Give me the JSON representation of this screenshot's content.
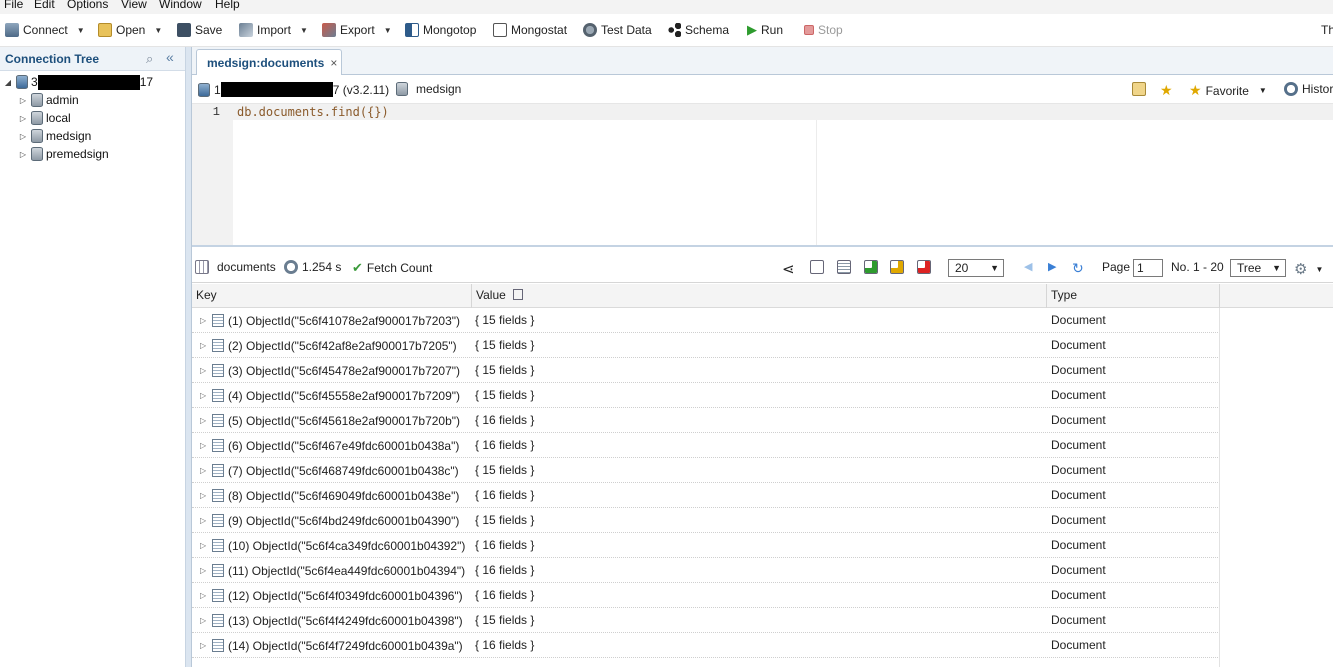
{
  "menu": [
    "File",
    "Edit",
    "Options",
    "View",
    "Window",
    "Help"
  ],
  "toolbar": {
    "connect": "Connect",
    "open": "Open",
    "save": "Save",
    "import": "Import",
    "export": "Export",
    "mongotop": "Mongotop",
    "mongostat": "Mongostat",
    "test_data": "Test Data",
    "schema": "Schema",
    "run": "Run",
    "stop": "Stop",
    "overflow": "Th"
  },
  "connection_tree": {
    "title": "Connection Tree",
    "root_prefix": "3",
    "root_suffix": "17",
    "databases": [
      "admin",
      "local",
      "medsign",
      "premedsign"
    ]
  },
  "tab": {
    "label": "medsign:documents",
    "close": "×"
  },
  "info": {
    "server_prefix": "1",
    "server_suffix": "7 (v3.2.11)",
    "database": "medsign",
    "favorite": "Favorite",
    "history": "Histor"
  },
  "editor": {
    "line_number": "1",
    "code": "db.documents.find({})"
  },
  "results": {
    "collection": "documents",
    "time": "1.254 s",
    "fetch_count": "Fetch Count",
    "page_size": "20",
    "page_label": "Page",
    "page": "1",
    "range": "No. 1 - 20",
    "view_mode": "Tree"
  },
  "table": {
    "columns": [
      "Key",
      "Value",
      "Type"
    ],
    "rows": [
      {
        "key": "(1) ObjectId(\"5c6f41078e2af900017b7203\")",
        "value": "{ 15 fields }",
        "type": "Document"
      },
      {
        "key": "(2) ObjectId(\"5c6f42af8e2af900017b7205\")",
        "value": "{ 15 fields }",
        "type": "Document"
      },
      {
        "key": "(3) ObjectId(\"5c6f45478e2af900017b7207\")",
        "value": "{ 15 fields }",
        "type": "Document"
      },
      {
        "key": "(4) ObjectId(\"5c6f45558e2af900017b7209\")",
        "value": "{ 15 fields }",
        "type": "Document"
      },
      {
        "key": "(5) ObjectId(\"5c6f45618e2af900017b720b\")",
        "value": "{ 16 fields }",
        "type": "Document"
      },
      {
        "key": "(6) ObjectId(\"5c6f467e49fdc60001b0438a\")",
        "value": "{ 16 fields }",
        "type": "Document"
      },
      {
        "key": "(7) ObjectId(\"5c6f468749fdc60001b0438c\")",
        "value": "{ 15 fields }",
        "type": "Document"
      },
      {
        "key": "(8) ObjectId(\"5c6f469049fdc60001b0438e\")",
        "value": "{ 16 fields }",
        "type": "Document"
      },
      {
        "key": "(9) ObjectId(\"5c6f4bd249fdc60001b04390\")",
        "value": "{ 15 fields }",
        "type": "Document"
      },
      {
        "key": "(10) ObjectId(\"5c6f4ca349fdc60001b04392\")",
        "value": "{ 16 fields }",
        "type": "Document"
      },
      {
        "key": "(11) ObjectId(\"5c6f4ea449fdc60001b04394\")",
        "value": "{ 16 fields }",
        "type": "Document"
      },
      {
        "key": "(12) ObjectId(\"5c6f4f0349fdc60001b04396\")",
        "value": "{ 16 fields }",
        "type": "Document"
      },
      {
        "key": "(13) ObjectId(\"5c6f4f4249fdc60001b04398\")",
        "value": "{ 15 fields }",
        "type": "Document"
      },
      {
        "key": "(14) ObjectId(\"5c6f4f7249fdc60001b0439a\")",
        "value": "{ 16 fields }",
        "type": "Document"
      }
    ]
  },
  "colors": {
    "accent": "#1d4f7c",
    "panel_border": "#b9c8d8",
    "run_green": "#2e9b2e",
    "stop_red": "#d36a6a",
    "nav_blue": "#3a7fd5"
  }
}
